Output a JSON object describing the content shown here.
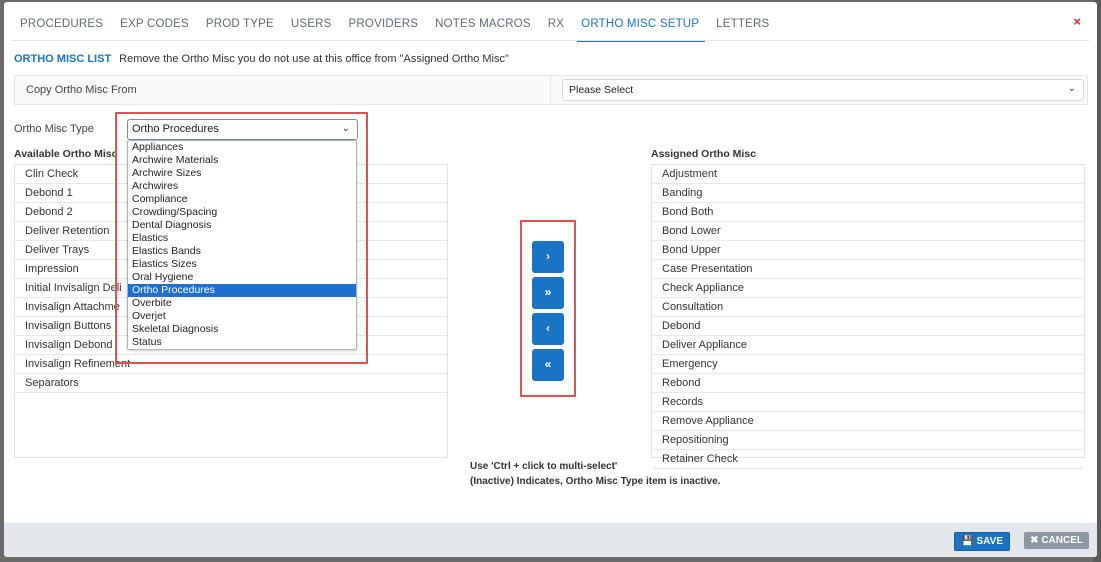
{
  "tabs": [
    {
      "label": "PROCEDURES"
    },
    {
      "label": "EXP CODES"
    },
    {
      "label": "PROD TYPE"
    },
    {
      "label": "USERS"
    },
    {
      "label": "PROVIDERS"
    },
    {
      "label": "NOTES MACROS"
    },
    {
      "label": "RX"
    },
    {
      "label": "ORTHO MISC SETUP",
      "active": true
    },
    {
      "label": "LETTERS"
    }
  ],
  "close_icon": "×",
  "list_header": {
    "title": "ORTHO MISC LIST",
    "description": "Remove the Ortho Misc you do not use at this office from \"Assigned Ortho Misc\""
  },
  "copy": {
    "label": "Copy Ortho Misc From",
    "value": "Please Select"
  },
  "type": {
    "label": "Ortho Misc Type",
    "value": "Ortho Procedures",
    "options": [
      "Appliances",
      "Archwire Materials",
      "Archwire Sizes",
      "Archwires",
      "Compliance",
      "Crowding/Spacing",
      "Dental Diagnosis",
      "Elastics",
      "Elastics Bands",
      "Elastics Sizes",
      "Oral Hygiene",
      "Ortho Procedures",
      "Overbite",
      "Overjet",
      "Skeletal Diagnosis",
      "Status"
    ],
    "selected_index": 11
  },
  "available": {
    "header": "Available Ortho Misc",
    "items": [
      "Clin Check",
      "Debond 1",
      "Debond 2",
      "Deliver Retention",
      "Deliver Trays",
      "Impression",
      "Initial Invisalign Deli",
      "Invisalign Attachme",
      "Invisalign Buttons",
      "Invisalign Debond",
      "Invisalign Refinement",
      "Separators"
    ]
  },
  "assigned": {
    "header": "Assigned Ortho Misc",
    "items": [
      "Adjustment",
      "Banding",
      "Bond Both",
      "Bond Lower",
      "Bond Upper",
      "Case Presentation",
      "Check Appliance",
      "Consultation",
      "Debond",
      "Deliver Appliance",
      "Emergency",
      "Rebond",
      "Records",
      "Remove Appliance",
      "Repositioning",
      "Retainer Check"
    ]
  },
  "move_buttons": [
    "›",
    "»",
    "‹",
    "«"
  ],
  "notes": [
    "Use 'Ctrl + click to multi-select'",
    "(Inactive) Indicates, Ortho Misc Type item is inactive."
  ],
  "footer": {
    "save": "SAVE",
    "cancel": "CANCEL"
  },
  "colors": {
    "accent": "#1a74c5",
    "highlight_box": "#e05252",
    "close": "#d9232a"
  }
}
